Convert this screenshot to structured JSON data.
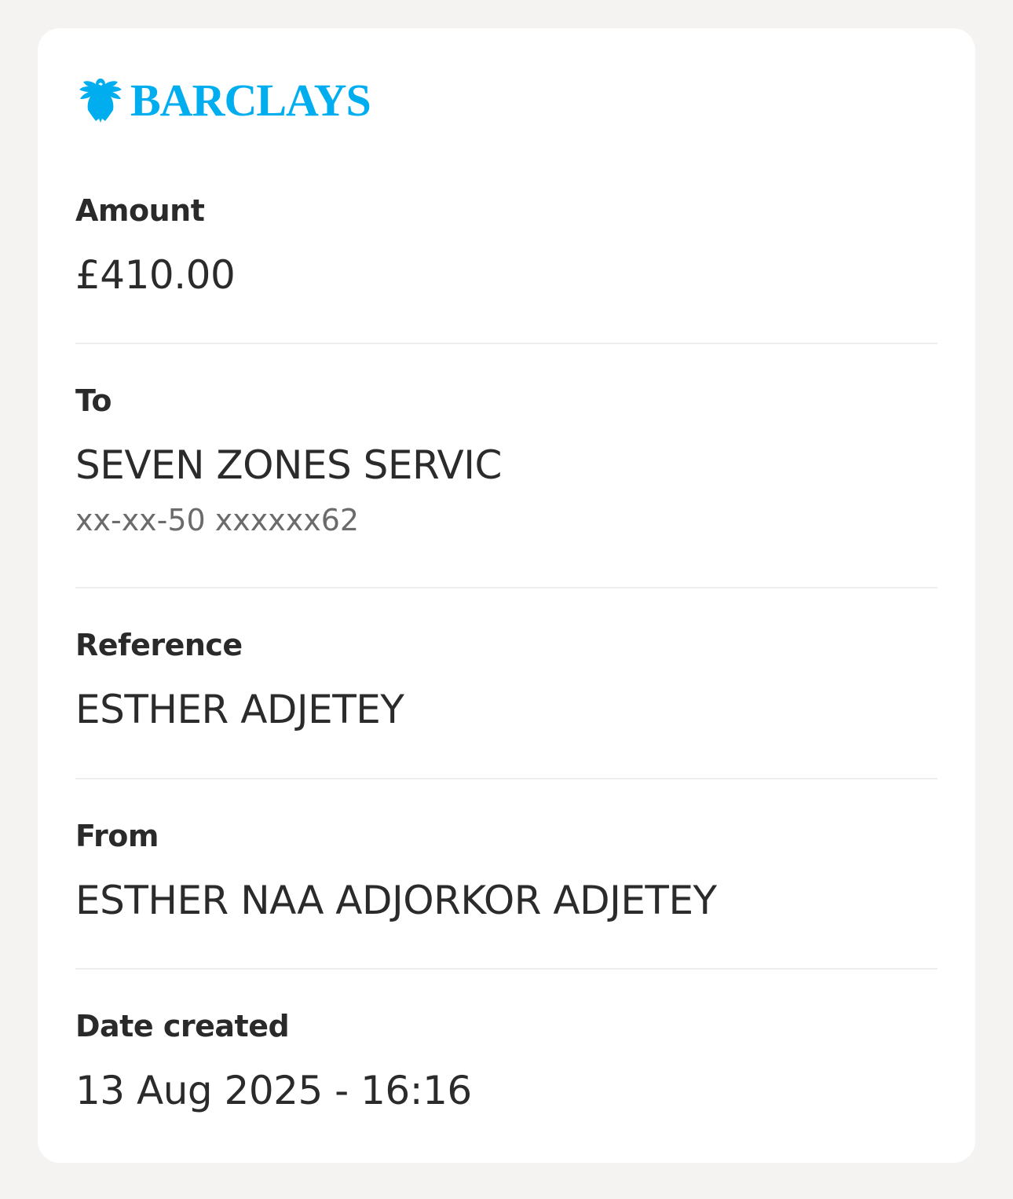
{
  "brand": {
    "name": "BARCLAYS",
    "color": "#00aeef",
    "icon": "eagle-icon"
  },
  "amount": {
    "label": "Amount",
    "value": "£410.00"
  },
  "to": {
    "label": "To",
    "name": "SEVEN ZONES SERVIC",
    "account": "xx-xx-50 xxxxxx62"
  },
  "reference": {
    "label": "Reference",
    "value": "ESTHER ADJETEY"
  },
  "from": {
    "label": "From",
    "value": "ESTHER NAA ADJORKOR ADJETEY"
  },
  "date_created": {
    "label": "Date created",
    "value": "13 Aug 2025 - 16:16"
  }
}
